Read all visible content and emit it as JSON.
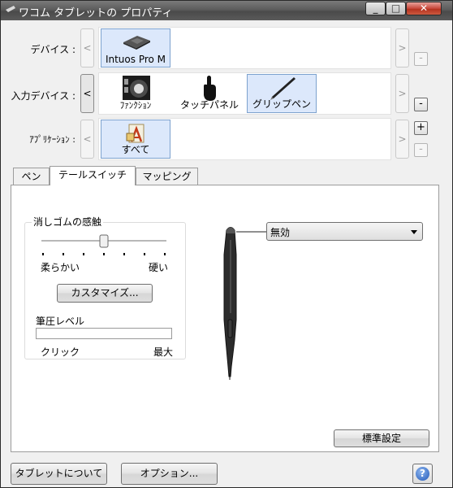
{
  "window": {
    "title": "ワコム タブレットの プロパティ"
  },
  "rows": {
    "device": {
      "label": "デバイス :",
      "items": [
        {
          "label": "Intuos Pro M",
          "icon": "tablet-icon",
          "selected": true
        }
      ]
    },
    "input_device": {
      "label": "入力デバイス :",
      "items": [
        {
          "label": "ﾌｧﾝｸｼｮﾝ",
          "icon": "express-key-wheel-icon",
          "selected": false
        },
        {
          "label": "タッチパネル",
          "icon": "touch-hand-icon",
          "selected": false
        },
        {
          "label": "グリップペン",
          "icon": "grip-pen-icon",
          "selected": true
        }
      ]
    },
    "application": {
      "label": "ｱﾌﾟﾘｹｰｼｮﾝ :",
      "items": [
        {
          "label": "すべて",
          "icon": "all-applications-icon",
          "selected": true
        }
      ]
    }
  },
  "buttons": {
    "prev": "<",
    "next": ">",
    "add": "+",
    "remove": "-"
  },
  "tabs": [
    {
      "label": "ペン",
      "active": false
    },
    {
      "label": "テールスイッチ",
      "active": true
    },
    {
      "label": "マッピング",
      "active": false
    }
  ],
  "eraser": {
    "group_title": "消しゴムの感触",
    "slider_level": 0.5,
    "slider_ticks": 7,
    "min_label": "柔らかい",
    "max_label": "硬い",
    "customize_label": "カスタマイズ..."
  },
  "pressure": {
    "title": "筆圧レベル",
    "min_label": "クリック",
    "max_label": "最大",
    "level": 0
  },
  "tail_function": {
    "selected": "無効"
  },
  "default_button": "標準設定",
  "footer": {
    "about_label": "タブレットについて",
    "options_label": "オプション...",
    "help_label": "?"
  },
  "colors": {
    "selection_bg": "#dce8fb",
    "selection_border": "#7da2ce",
    "titlebar": "#5c5c5c"
  }
}
